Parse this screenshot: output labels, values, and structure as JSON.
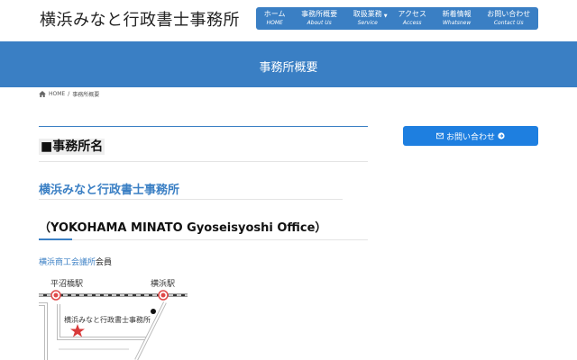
{
  "header": {
    "site_title": "横浜みなと行政書士事務所",
    "nav": [
      {
        "jp": "ホーム",
        "en": "HOME"
      },
      {
        "jp": "事務所概要",
        "en": "About Us"
      },
      {
        "jp": "取扱業務",
        "en": "Service"
      },
      {
        "jp": "アクセス",
        "en": "Access"
      },
      {
        "jp": "新着情報",
        "en": "Whatsnew"
      },
      {
        "jp": "お問い合わせ",
        "en": "Contact Us"
      }
    ]
  },
  "banner": {
    "title": "事務所概要"
  },
  "breadcrumb": {
    "home": "HOME",
    "separator": "/",
    "current": "事務所概要"
  },
  "main": {
    "section_heading": "■事務所名",
    "office_name": "横浜みなと行政書士事務所",
    "office_name_en": "（YOKOHAMA MINATO Gyoseisyoshi Office）",
    "member_link": "横浜商工会議所",
    "member_suffix": "会員",
    "map": {
      "station_left": "平沼橋駅",
      "station_right": "横浜駅",
      "office_label": "横浜みなと行政書士事務所"
    }
  },
  "sidebar": {
    "contact_button": "お問い合わせ"
  },
  "colors": {
    "primary": "#3a7fc4",
    "button": "#1e7fe0",
    "map_marker": "#d83a3a",
    "map_station": "#e04a4a"
  }
}
